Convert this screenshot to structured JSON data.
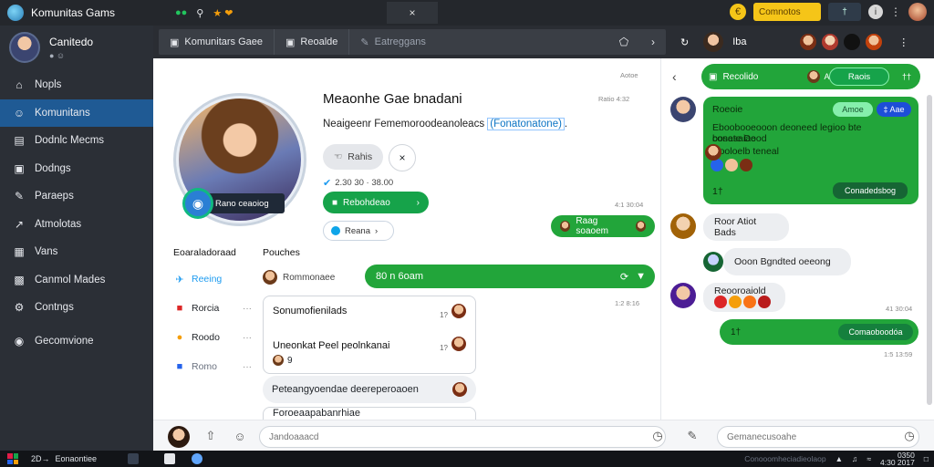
{
  "colors": {
    "accent": "#1f5a94",
    "green": "#22a53a",
    "sidebar": "#2b2f36",
    "topbar": "#24272c"
  },
  "topbar": {
    "title": "Komunitas Gams",
    "tab_icon_one": "gamepad-icon",
    "tab_text": "★ ❤",
    "close": "×",
    "coin_label": "€",
    "yellow_pill": "Comnotos",
    "dark_pill": "†",
    "info_label": "i"
  },
  "sidebar": {
    "profile_name": "Canitedo",
    "profile_sub": "● ☺",
    "items": [
      {
        "label": "Nopls",
        "icon": "home-icon",
        "glyph": "⌂"
      },
      {
        "label": "Komunitans",
        "icon": "people-icon",
        "glyph": "☺",
        "active": true
      },
      {
        "label": "Dodnlc Mecms",
        "icon": "document-icon",
        "glyph": "▤"
      },
      {
        "label": "Dodngs",
        "icon": "book-icon",
        "glyph": "▣"
      },
      {
        "label": "Paraeps",
        "icon": "pin-icon",
        "glyph": "✎"
      },
      {
        "label": "Atmolotas",
        "icon": "chart-icon",
        "glyph": "↗"
      },
      {
        "label": "Vans",
        "icon": "calendar-icon",
        "glyph": "▦"
      },
      {
        "label": "Canmol Mades",
        "icon": "grid-icon",
        "glyph": "▩"
      },
      {
        "label": "Contngs",
        "icon": "settings-icon",
        "glyph": "⚙"
      }
    ],
    "footer_item": {
      "label": "Gecomvione",
      "icon": "globe-icon",
      "glyph": "◉"
    }
  },
  "header": {
    "community_label": "Komunitars Gaee",
    "tab_two": "Reoalde",
    "tab_three": "Eatreggans"
  },
  "chat_header": {
    "name": "Iba"
  },
  "main": {
    "title": "Meaonhe Gae bnadani",
    "description": "Neaigeenr Fememoroodeanoleacs",
    "description_link": "(Fonatonatone)",
    "description_end": ".",
    "btn_gray": "Rahis",
    "btn_x": "×",
    "stats": "2.30 30 · 38.00",
    "btn_green": "Rebohdeao",
    "btn_green_end": "›",
    "btn_outline": "Reana",
    "btn_outline_end": "›",
    "hero_badge": "Rano ceaoiog",
    "ts_top": "Aotoe",
    "ts_title": "Ratio 4:32",
    "ts_bubble": "4:1 30:04",
    "ts_bar": "1:2 8:16",
    "bubble": "Raag soaoem",
    "green_bar": "80 n 6oam",
    "left_header": "Eoaraladoraad",
    "posts_header": "Pouches",
    "left_items": [
      {
        "label": "Reeing",
        "icon": "bird-icon",
        "glyph": "✈",
        "color": "#1d9bf0"
      },
      {
        "label": "Rorcia",
        "icon": "box-icon",
        "glyph": "■",
        "color": "#dc2626",
        "dots": "···"
      },
      {
        "label": "Roodo",
        "icon": "coin-icon",
        "glyph": "●",
        "color": "#f59e0b",
        "dots": "···"
      },
      {
        "label": "Romo",
        "icon": "square-icon",
        "glyph": "■",
        "color": "#2563eb",
        "dots": "···"
      }
    ],
    "posts_user": "Rommonaee",
    "posts": [
      {
        "text": "Sonumofienilads",
        "num": "1?"
      },
      {
        "text": "Uneonkat Peel peolnkanai",
        "num": "1?"
      },
      {
        "text": "Peteangyoendae deereperoaoen"
      },
      {
        "text": "Foroeaapabanrhiae"
      }
    ],
    "post_sub": "9"
  },
  "chat": {
    "back": "‹",
    "top_label": "Recolido",
    "top_inner": "Raois",
    "top_end": "††",
    "big_green": {
      "line1": "Roeoie",
      "pill1": "Amoe",
      "pill2": "‡ Aae",
      "line2": "Eboobooeooon deoneed legioo bte bosesaiae",
      "line3": "conate Dood",
      "line4": "Dooloelb teneal",
      "foot_left": "1†",
      "foot_pill": "Conadedsbog"
    },
    "msg1": "Roor Atiot Bads",
    "msg2": "Ooon Bgndted oeeong",
    "msg3": "Reooroaiold",
    "out_left": "1†",
    "out_inner": "Comaoboodóa",
    "ts1": "41 30:04",
    "ts2": "1:5 13:59"
  },
  "composer": {
    "placeholder": "Jandoaaacd",
    "placeholder2": "Gemanecusoahe"
  },
  "taskbar": {
    "start": "2D→",
    "app": "Eonaontiee",
    "right_text": "Conooomheciadieolaop",
    "time": "0350",
    "date": "4:30 2017"
  }
}
